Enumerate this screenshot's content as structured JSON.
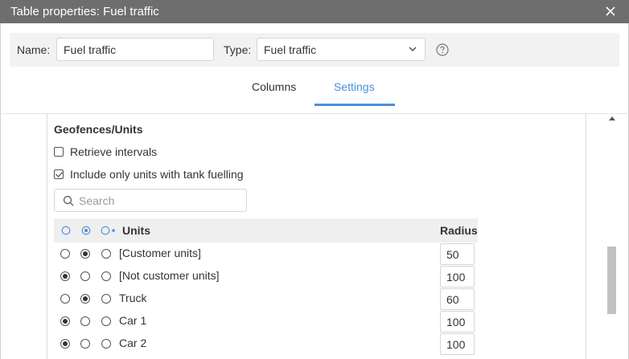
{
  "dialog": {
    "title": "Table properties: Fuel traffic"
  },
  "name_bar": {
    "name_label": "Name:",
    "name_value": "Fuel traffic",
    "type_label": "Type:",
    "type_value": "Fuel traffic"
  },
  "tabs": [
    {
      "label": "Columns",
      "active": false
    },
    {
      "label": "Settings",
      "active": true
    }
  ],
  "colors": {
    "accent": "#4a90d9",
    "titlebar": "#6e6e6e"
  },
  "section": {
    "title": "Geofences/Units",
    "options": [
      {
        "label": "Retrieve intervals",
        "checked": false
      },
      {
        "label": "Include only units with tank fuelling",
        "checked": true
      }
    ],
    "search_placeholder": "Search"
  },
  "table": {
    "headers": {
      "units": "Units",
      "radius": "Radius"
    },
    "rows": [
      {
        "unit": "[Customer units]",
        "selected": 1,
        "radius": "50"
      },
      {
        "unit": "[Not customer units]",
        "selected": 0,
        "radius": "100"
      },
      {
        "unit": "Truck",
        "selected": 1,
        "radius": "60"
      },
      {
        "unit": "Car 1",
        "selected": 0,
        "radius": "100"
      },
      {
        "unit": "Car 2",
        "selected": 0,
        "radius": "100"
      }
    ]
  }
}
